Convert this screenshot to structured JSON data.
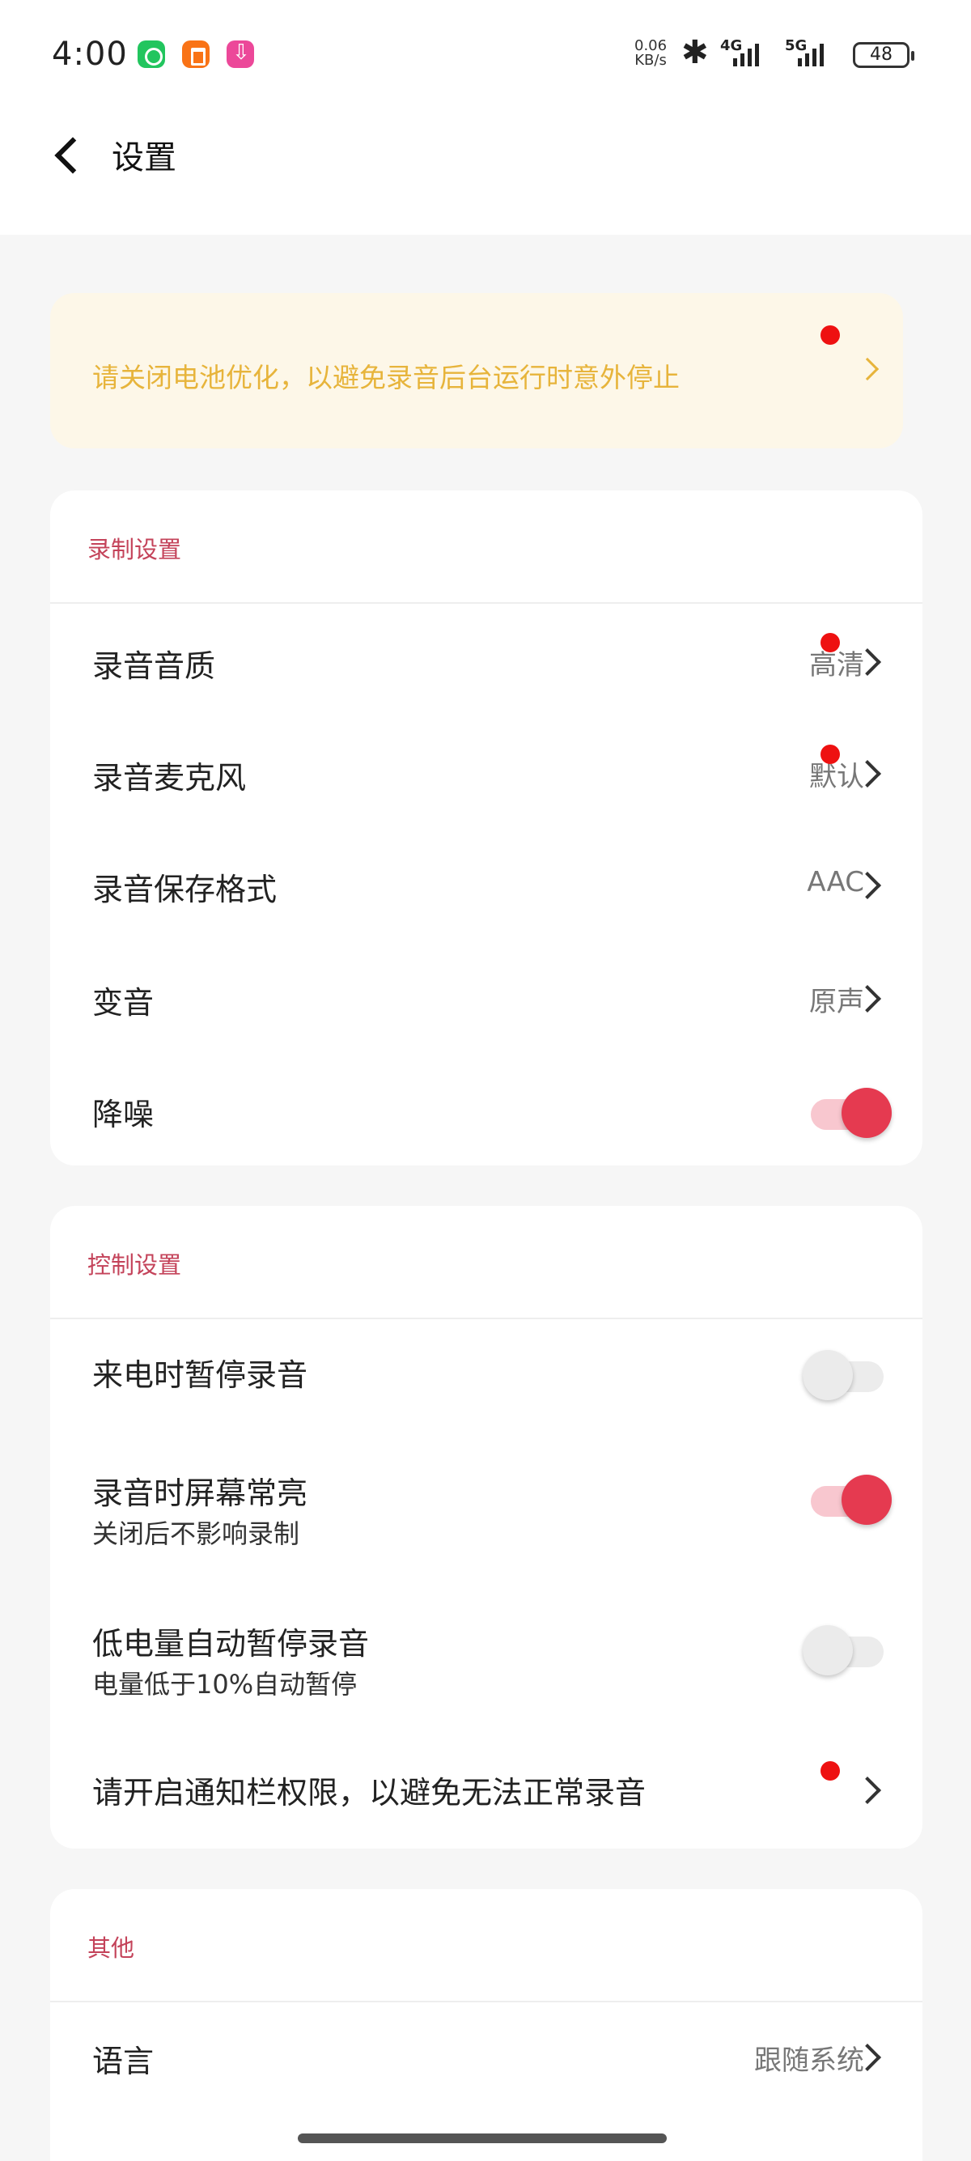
{
  "status_bar": {
    "time": "4:00",
    "net_speed_value": "0.06",
    "net_speed_unit": "KB/s",
    "bluetooth_icon": "bluetooth-icon",
    "signal_1_label": "4G",
    "signal_2_label": "5G",
    "battery": "48"
  },
  "header": {
    "title": "设置",
    "back_icon": "chevron-left-icon"
  },
  "banner": {
    "text": "请关闭电池优化，以避免录音后台运行时意外停止"
  },
  "recording_settings": {
    "title": "录制设置",
    "rows": [
      {
        "label": "录音音质",
        "value": "高清"
      },
      {
        "label": "录音麦克风",
        "value": "默认"
      },
      {
        "label": "录音保存格式",
        "value": "AAC"
      },
      {
        "label": "变音",
        "value": "原声"
      },
      {
        "label": "降噪",
        "toggle": true
      }
    ]
  },
  "control_settings": {
    "title": "控制设置",
    "rows": [
      {
        "label": "来电时暂停录音",
        "toggle": false
      },
      {
        "label": "录音时屏幕常亮",
        "sub": "关闭后不影响录制",
        "toggle": true
      },
      {
        "label": "低电量自动暂停录音",
        "sub": "电量低于10%自动暂停",
        "toggle": false
      },
      {
        "label": "请开启通知栏权限，以避免无法正常录音"
      }
    ]
  },
  "other": {
    "title": "其他",
    "rows": [
      {
        "label": "语言",
        "value": "跟随系统"
      }
    ]
  },
  "colors": {
    "accent": "#e53a50",
    "section_title": "#c4435a",
    "banner_bg": "#fdf7e8",
    "banner_text": "#e7b43b",
    "badge": "#ee1111"
  }
}
